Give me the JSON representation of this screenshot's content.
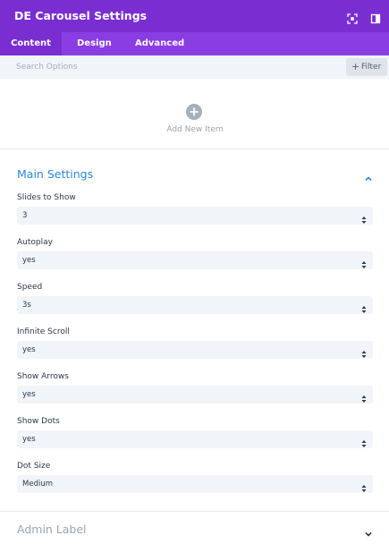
{
  "header": {
    "title": "DE Carousel Settings",
    "icons": [
      "expand-icon",
      "sidebar-toggle-icon"
    ]
  },
  "tabs": [
    {
      "label": "Content",
      "active": true
    },
    {
      "label": "Design",
      "active": false
    },
    {
      "label": "Advanced",
      "active": false
    }
  ],
  "search": {
    "placeholder": "Search Options",
    "filter_label": "Filter"
  },
  "add_item": {
    "label": "Add New Item"
  },
  "main_settings": {
    "title": "Main Settings",
    "expanded": true,
    "fields": [
      {
        "label": "Slides to Show",
        "value": "3"
      },
      {
        "label": "Autoplay",
        "value": "yes"
      },
      {
        "label": "Speed",
        "value": "3s"
      },
      {
        "label": "Infinite Scroll",
        "value": "yes"
      },
      {
        "label": "Show Arrows",
        "value": "yes"
      },
      {
        "label": "Show Dots",
        "value": "yes"
      },
      {
        "label": "Dot Size",
        "value": "Medium"
      }
    ]
  },
  "admin_label": {
    "title": "Admin Label",
    "expanded": false
  },
  "colors": {
    "header_bg": "#7a2ed1",
    "tab_bar_bg": "#8a3de3",
    "accent_blue": "#2b87da",
    "field_bg": "#f1f4f8"
  }
}
